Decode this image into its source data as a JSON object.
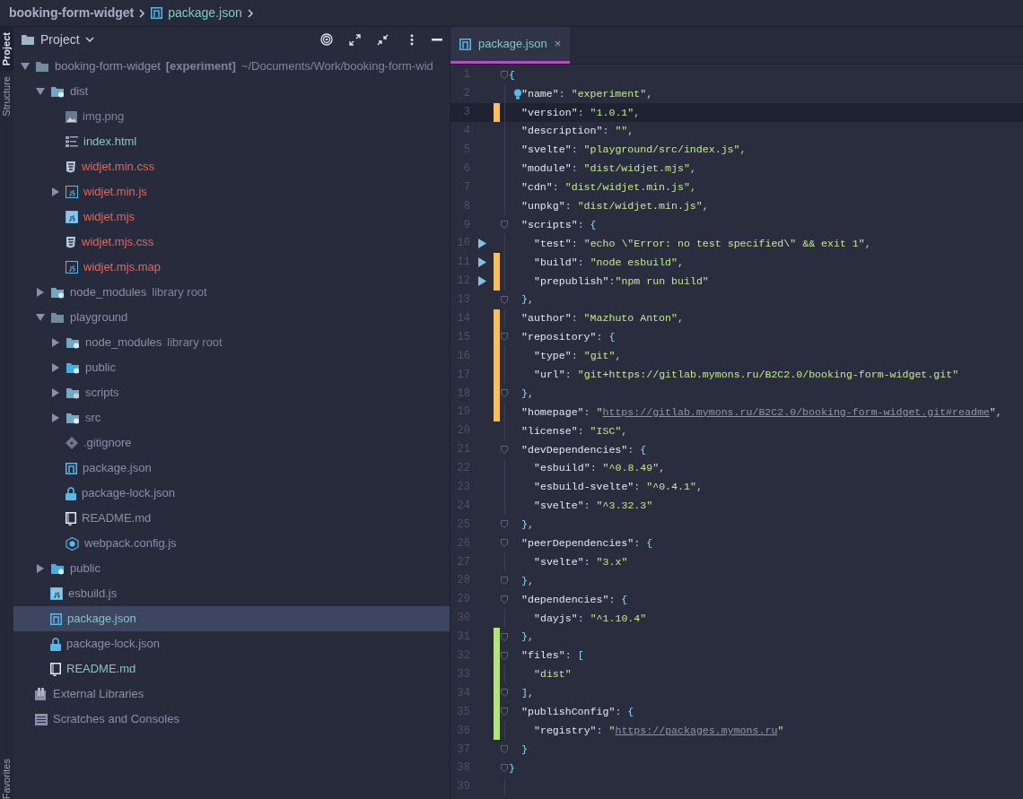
{
  "breadcrumb": {
    "project": "booking-form-widget",
    "file": "package.json"
  },
  "sidebar_tabs": [
    {
      "label": "Project",
      "selected": true
    },
    {
      "label": "Structure",
      "selected": false
    }
  ],
  "bottom_tab": {
    "label": "Favorites"
  },
  "project_panel": {
    "title": "Project",
    "tree": [
      {
        "kind": "folder",
        "label": "booking-form-widget",
        "tag": "[experiment]",
        "path": "~/Documents/Work/booking-form-wid",
        "color": "#8a90ab",
        "expanded": true,
        "selected": false,
        "children": [
          {
            "kind": "folder-dist",
            "label": "dist",
            "color": "#8a90ab",
            "expanded": true,
            "selected": false,
            "children": [
              {
                "kind": "image",
                "label": "img.png",
                "color": "#7f8499",
                "selected": false
              },
              {
                "kind": "html",
                "label": "index.html",
                "color": "#7fc9c2",
                "selected": false
              },
              {
                "kind": "css",
                "label": "widjet.min.css",
                "color": "#e2675c",
                "selected": false
              },
              {
                "kind": "js-folder",
                "label": "widjet.min.js",
                "color": "#e2675c",
                "expanded": false,
                "selected": false
              },
              {
                "kind": "js",
                "label": "widjet.mjs",
                "color": "#e2675c",
                "selected": false
              },
              {
                "kind": "css",
                "label": "widjet.mjs.css",
                "color": "#e2675c",
                "selected": false
              },
              {
                "kind": "map",
                "label": "widjet.mjs.map",
                "color": "#e2675c",
                "selected": false
              }
            ]
          },
          {
            "kind": "folder-modules",
            "label": "node_modules",
            "tag": "library root",
            "color": "#8a90ab",
            "expanded": false,
            "selected": false
          },
          {
            "kind": "folder",
            "label": "playground",
            "color": "#8a90ab",
            "expanded": true,
            "selected": false,
            "children": [
              {
                "kind": "folder-modules",
                "label": "node_modules",
                "tag": "library root",
                "color": "#8a90ab",
                "expanded": false,
                "selected": false
              },
              {
                "kind": "folder-web",
                "label": "public",
                "color": "#8a90ab",
                "expanded": false,
                "selected": false
              },
              {
                "kind": "folder-scripts",
                "label": "scripts",
                "color": "#8a90ab",
                "expanded": false,
                "selected": false
              },
              {
                "kind": "folder-src",
                "label": "src",
                "color": "#8a90ab",
                "expanded": false,
                "selected": false
              },
              {
                "kind": "git",
                "label": ".gitignore",
                "color": "#8a90ab",
                "selected": false
              },
              {
                "kind": "npm",
                "label": "package.json",
                "color": "#8a90ab",
                "selected": false
              },
              {
                "kind": "lock",
                "label": "package-lock.json",
                "color": "#8a90ab",
                "selected": false
              },
              {
                "kind": "readme",
                "label": "README.md",
                "color": "#8a90ab",
                "selected": false
              },
              {
                "kind": "webpack",
                "label": "webpack.config.js",
                "color": "#8a90ab",
                "selected": false
              }
            ]
          },
          {
            "kind": "folder-web",
            "label": "public",
            "color": "#8a90ab",
            "expanded": false,
            "selected": false
          },
          {
            "kind": "js",
            "label": "esbuild.js",
            "color": "#8a90ab",
            "selected": false
          },
          {
            "kind": "npm",
            "label": "package.json",
            "color": "#7fc9c2",
            "selected": true
          },
          {
            "kind": "lock",
            "label": "package-lock.json",
            "color": "#8a90ab",
            "selected": false
          },
          {
            "kind": "readme",
            "label": "README.md",
            "color": "#7fc9c2",
            "selected": false
          }
        ]
      },
      {
        "kind": "library",
        "label": "External Libraries",
        "color": "#8a90ab",
        "selected": false
      },
      {
        "kind": "scratches",
        "label": "Scratches and Consoles",
        "color": "#8a90ab",
        "selected": false
      }
    ]
  },
  "editor": {
    "tabs": [
      {
        "label": "package.json",
        "close": "×",
        "selected": true
      }
    ],
    "lines": [
      {
        "n": "1",
        "modified": false,
        "added": false,
        "run": false,
        "fold": true,
        "current": false,
        "bulb": false,
        "tokens": [
          {
            "kind": "punct",
            "text": "{"
          }
        ]
      },
      {
        "n": "2",
        "modified": false,
        "added": false,
        "run": false,
        "fold": false,
        "current": false,
        "bulb": true,
        "tokens": [
          {
            "kind": "key",
            "text": "\"name\""
          },
          {
            "kind": "colon",
            "text": ": "
          },
          {
            "kind": "string",
            "text": "\"experiment\""
          },
          {
            "kind": "colon",
            "text": ","
          }
        ]
      },
      {
        "n": "3",
        "modified": true,
        "added": false,
        "run": false,
        "fold": false,
        "current": true,
        "bulb": false,
        "tokens": [
          {
            "kind": "key",
            "text": "\"version\""
          },
          {
            "kind": "colon",
            "text": ": "
          },
          {
            "kind": "string",
            "text": "\"1.0.1\""
          },
          {
            "kind": "colon",
            "text": ","
          }
        ]
      },
      {
        "n": "4",
        "modified": false,
        "added": false,
        "run": false,
        "fold": false,
        "current": false,
        "bulb": false,
        "tokens": [
          {
            "kind": "key",
            "text": "\"description\""
          },
          {
            "kind": "colon",
            "text": ": "
          },
          {
            "kind": "string",
            "text": "\"\""
          },
          {
            "kind": "colon",
            "text": ","
          }
        ]
      },
      {
        "n": "5",
        "modified": false,
        "added": false,
        "run": false,
        "fold": false,
        "current": false,
        "bulb": false,
        "tokens": [
          {
            "kind": "key",
            "text": "\"svelte\""
          },
          {
            "kind": "colon",
            "text": ": "
          },
          {
            "kind": "string",
            "text": "\"playground/src/index.js\""
          },
          {
            "kind": "colon",
            "text": ","
          }
        ]
      },
      {
        "n": "6",
        "modified": false,
        "added": false,
        "run": false,
        "fold": false,
        "current": false,
        "bulb": false,
        "tokens": [
          {
            "kind": "key",
            "text": "\"module\""
          },
          {
            "kind": "colon",
            "text": ": "
          },
          {
            "kind": "string",
            "text": "\"dist/widjet.mjs\""
          },
          {
            "kind": "colon",
            "text": ","
          }
        ]
      },
      {
        "n": "7",
        "modified": false,
        "added": false,
        "run": false,
        "fold": false,
        "current": false,
        "bulb": false,
        "tokens": [
          {
            "kind": "key",
            "text": "\"cdn\""
          },
          {
            "kind": "colon",
            "text": ": "
          },
          {
            "kind": "string",
            "text": "\"dist/widjet.min.js\""
          },
          {
            "kind": "colon",
            "text": ","
          }
        ]
      },
      {
        "n": "8",
        "modified": false,
        "added": false,
        "run": false,
        "fold": false,
        "current": false,
        "bulb": false,
        "tokens": [
          {
            "kind": "key",
            "text": "\"unpkg\""
          },
          {
            "kind": "colon",
            "text": ": "
          },
          {
            "kind": "string",
            "text": "\"dist/widjet.min.js\""
          },
          {
            "kind": "colon",
            "text": ","
          }
        ]
      },
      {
        "n": "9",
        "modified": false,
        "added": false,
        "run": false,
        "fold": true,
        "current": false,
        "bulb": false,
        "tokens": [
          {
            "kind": "key",
            "text": "\"scripts\""
          },
          {
            "kind": "colon",
            "text": ": "
          },
          {
            "kind": "punct",
            "text": "{"
          }
        ]
      },
      {
        "n": "10",
        "modified": false,
        "added": false,
        "run": true,
        "fold": false,
        "current": false,
        "bulb": false,
        "tokens": [
          {
            "kind": "key",
            "text": "\"test\""
          },
          {
            "kind": "colon",
            "text": ": "
          },
          {
            "kind": "string",
            "text": "\"echo \\\"Error: no test specified\\\" && exit 1\""
          },
          {
            "kind": "colon",
            "text": ","
          }
        ]
      },
      {
        "n": "11",
        "modified": true,
        "added": false,
        "run": true,
        "fold": false,
        "current": false,
        "bulb": false,
        "tokens": [
          {
            "kind": "key",
            "text": "\"build\""
          },
          {
            "kind": "colon",
            "text": ": "
          },
          {
            "kind": "string",
            "text": "\"node esbuild\""
          },
          {
            "kind": "colon",
            "text": ","
          }
        ]
      },
      {
        "n": "12",
        "modified": true,
        "added": false,
        "run": true,
        "fold": false,
        "current": false,
        "bulb": false,
        "tokens": [
          {
            "kind": "key",
            "text": "\"prepublish\""
          },
          {
            "kind": "colon",
            "text": ":"
          },
          {
            "kind": "string",
            "text": "\"npm run build\""
          }
        ]
      },
      {
        "n": "13",
        "modified": false,
        "added": false,
        "run": false,
        "fold": true,
        "current": false,
        "bulb": false,
        "tokens": [
          {
            "kind": "punct",
            "text": "}"
          },
          {
            "kind": "colon",
            "text": ","
          }
        ]
      },
      {
        "n": "14",
        "modified": true,
        "added": false,
        "run": false,
        "fold": false,
        "current": false,
        "bulb": false,
        "tokens": [
          {
            "kind": "key",
            "text": "\"author\""
          },
          {
            "kind": "colon",
            "text": ": "
          },
          {
            "kind": "string",
            "text": "\"Mazhuto Anton\""
          },
          {
            "kind": "colon",
            "text": ","
          }
        ]
      },
      {
        "n": "15",
        "modified": true,
        "added": false,
        "run": false,
        "fold": true,
        "current": false,
        "bulb": false,
        "tokens": [
          {
            "kind": "key",
            "text": "\"repository\""
          },
          {
            "kind": "colon",
            "text": ": "
          },
          {
            "kind": "punct",
            "text": "{"
          }
        ]
      },
      {
        "n": "16",
        "modified": true,
        "added": false,
        "run": false,
        "fold": false,
        "current": false,
        "bulb": false,
        "tokens": [
          {
            "kind": "key",
            "text": "\"type\""
          },
          {
            "kind": "colon",
            "text": ": "
          },
          {
            "kind": "string",
            "text": "\"git\""
          },
          {
            "kind": "colon",
            "text": ","
          }
        ]
      },
      {
        "n": "17",
        "modified": true,
        "added": false,
        "run": false,
        "fold": false,
        "current": false,
        "bulb": false,
        "tokens": [
          {
            "kind": "key",
            "text": "\"url\""
          },
          {
            "kind": "colon",
            "text": ": "
          },
          {
            "kind": "string",
            "text": "\"git+https://gitlab.mymons.ru/B2C2.0/booking-form-widget.git\""
          }
        ]
      },
      {
        "n": "18",
        "modified": true,
        "added": false,
        "run": false,
        "fold": true,
        "current": false,
        "bulb": false,
        "tokens": [
          {
            "kind": "punct",
            "text": "}"
          },
          {
            "kind": "colon",
            "text": ","
          }
        ]
      },
      {
        "n": "19",
        "modified": true,
        "added": false,
        "run": false,
        "fold": false,
        "current": false,
        "bulb": false,
        "tokens": [
          {
            "kind": "key",
            "text": "\"homepage\""
          },
          {
            "kind": "colon",
            "text": ": "
          },
          {
            "kind": "string",
            "text": "\""
          },
          {
            "kind": "link",
            "text": "https://gitlab.mymons.ru/B2C2.0/booking-form-widget.git#readme"
          },
          {
            "kind": "string",
            "text": "\""
          },
          {
            "kind": "colon",
            "text": ","
          }
        ]
      },
      {
        "n": "20",
        "modified": false,
        "added": false,
        "run": false,
        "fold": false,
        "current": false,
        "bulb": false,
        "tokens": [
          {
            "kind": "key",
            "text": "\"license\""
          },
          {
            "kind": "colon",
            "text": ": "
          },
          {
            "kind": "string",
            "text": "\"ISC\""
          },
          {
            "kind": "colon",
            "text": ","
          }
        ]
      },
      {
        "n": "21",
        "modified": false,
        "added": false,
        "run": false,
        "fold": true,
        "current": false,
        "bulb": false,
        "tokens": [
          {
            "kind": "key",
            "text": "\"devDependencies\""
          },
          {
            "kind": "colon",
            "text": ": "
          },
          {
            "kind": "punct",
            "text": "{"
          }
        ]
      },
      {
        "n": "22",
        "modified": false,
        "added": false,
        "run": false,
        "fold": false,
        "current": false,
        "bulb": false,
        "tokens": [
          {
            "kind": "key",
            "text": "\"esbuild\""
          },
          {
            "kind": "colon",
            "text": ": "
          },
          {
            "kind": "string",
            "text": "\"^0.8.49\""
          },
          {
            "kind": "colon",
            "text": ","
          }
        ]
      },
      {
        "n": "23",
        "modified": false,
        "added": false,
        "run": false,
        "fold": false,
        "current": false,
        "bulb": false,
        "tokens": [
          {
            "kind": "key",
            "text": "\"esbuild-svelte\""
          },
          {
            "kind": "colon",
            "text": ": "
          },
          {
            "kind": "string",
            "text": "\"^0.4.1\""
          },
          {
            "kind": "colon",
            "text": ","
          }
        ]
      },
      {
        "n": "24",
        "modified": false,
        "added": false,
        "run": false,
        "fold": false,
        "current": false,
        "bulb": false,
        "tokens": [
          {
            "kind": "key",
            "text": "\"svelte\""
          },
          {
            "kind": "colon",
            "text": ": "
          },
          {
            "kind": "string",
            "text": "\"^3.32.3\""
          }
        ]
      },
      {
        "n": "25",
        "modified": false,
        "added": false,
        "run": false,
        "fold": true,
        "current": false,
        "bulb": false,
        "tokens": [
          {
            "kind": "punct",
            "text": "}"
          },
          {
            "kind": "colon",
            "text": ","
          }
        ]
      },
      {
        "n": "26",
        "modified": false,
        "added": false,
        "run": false,
        "fold": true,
        "current": false,
        "bulb": false,
        "tokens": [
          {
            "kind": "key",
            "text": "\"peerDependencies\""
          },
          {
            "kind": "colon",
            "text": ": "
          },
          {
            "kind": "punct",
            "text": "{"
          }
        ]
      },
      {
        "n": "27",
        "modified": false,
        "added": false,
        "run": false,
        "fold": false,
        "current": false,
        "bulb": false,
        "tokens": [
          {
            "kind": "key",
            "text": "\"svelte\""
          },
          {
            "kind": "colon",
            "text": ": "
          },
          {
            "kind": "string",
            "text": "\"3.x\""
          }
        ]
      },
      {
        "n": "28",
        "modified": false,
        "added": false,
        "run": false,
        "fold": true,
        "current": false,
        "bulb": false,
        "tokens": [
          {
            "kind": "punct",
            "text": "}"
          },
          {
            "kind": "colon",
            "text": ","
          }
        ]
      },
      {
        "n": "29",
        "modified": false,
        "added": false,
        "run": false,
        "fold": true,
        "current": false,
        "bulb": false,
        "tokens": [
          {
            "kind": "key",
            "text": "\"dependencies\""
          },
          {
            "kind": "colon",
            "text": ": "
          },
          {
            "kind": "punct",
            "text": "{"
          }
        ]
      },
      {
        "n": "30",
        "modified": false,
        "added": false,
        "run": false,
        "fold": false,
        "current": false,
        "bulb": false,
        "tokens": [
          {
            "kind": "key",
            "text": "\"dayjs\""
          },
          {
            "kind": "colon",
            "text": ": "
          },
          {
            "kind": "string",
            "text": "\"^1.10.4\""
          }
        ]
      },
      {
        "n": "31",
        "modified": false,
        "added": true,
        "run": false,
        "fold": true,
        "current": false,
        "bulb": false,
        "tokens": [
          {
            "kind": "punct",
            "text": "}"
          },
          {
            "kind": "colon",
            "text": ","
          }
        ]
      },
      {
        "n": "32",
        "modified": false,
        "added": true,
        "run": false,
        "fold": true,
        "current": false,
        "bulb": false,
        "tokens": [
          {
            "kind": "key",
            "text": "\"files\""
          },
          {
            "kind": "colon",
            "text": ": "
          },
          {
            "kind": "punct",
            "text": "["
          }
        ]
      },
      {
        "n": "33",
        "modified": false,
        "added": true,
        "run": false,
        "fold": false,
        "current": false,
        "bulb": false,
        "tokens": [
          {
            "kind": "string",
            "text": "\"dist\""
          }
        ]
      },
      {
        "n": "34",
        "modified": false,
        "added": true,
        "run": false,
        "fold": true,
        "current": false,
        "bulb": false,
        "tokens": [
          {
            "kind": "punct",
            "text": "]"
          },
          {
            "kind": "colon",
            "text": ","
          }
        ]
      },
      {
        "n": "35",
        "modified": false,
        "added": true,
        "run": false,
        "fold": true,
        "current": false,
        "bulb": false,
        "tokens": [
          {
            "kind": "key",
            "text": "\"publishConfig\""
          },
          {
            "kind": "colon",
            "text": ": "
          },
          {
            "kind": "punct",
            "text": "{"
          }
        ]
      },
      {
        "n": "36",
        "modified": false,
        "added": true,
        "run": false,
        "fold": false,
        "current": false,
        "bulb": false,
        "tokens": [
          {
            "kind": "key",
            "text": "\"registry\""
          },
          {
            "kind": "colon",
            "text": ": "
          },
          {
            "kind": "string",
            "text": "\""
          },
          {
            "kind": "link",
            "text": "https://packages.mymons.ru"
          },
          {
            "kind": "string",
            "text": "\""
          }
        ]
      },
      {
        "n": "37",
        "modified": false,
        "added": false,
        "run": false,
        "fold": true,
        "current": false,
        "bulb": false,
        "tokens": [
          {
            "kind": "punct",
            "text": "}"
          }
        ]
      },
      {
        "n": "38",
        "modified": false,
        "added": false,
        "run": false,
        "fold": true,
        "current": false,
        "bulb": false,
        "tokens": [
          {
            "kind": "punct",
            "text": "}"
          }
        ]
      },
      {
        "n": "39",
        "modified": false,
        "added": false,
        "run": false,
        "fold": false,
        "current": false,
        "bulb": false
      }
    ]
  }
}
